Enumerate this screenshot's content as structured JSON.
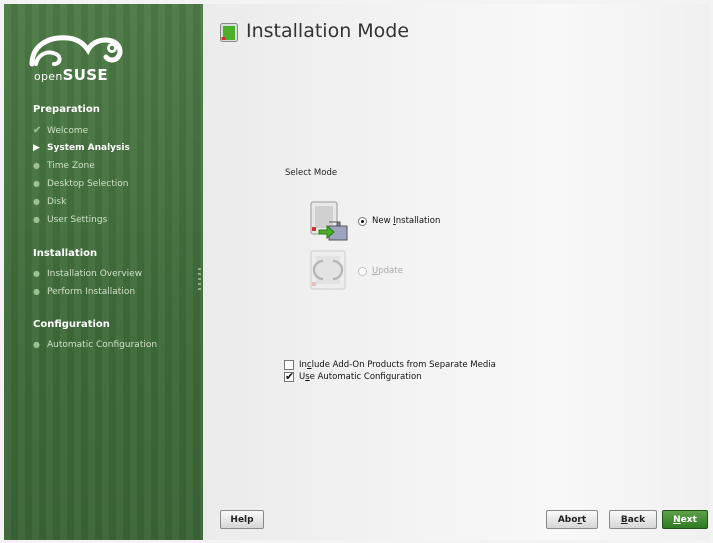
{
  "sidebar": {
    "logo": {
      "prefix": "open",
      "suffix": "SUSE",
      "icon": "chameleon-logo-icon"
    },
    "sections": [
      {
        "title": "Preparation",
        "steps": [
          {
            "label": "Welcome",
            "state": "done"
          },
          {
            "label": "System Analysis",
            "state": "current"
          },
          {
            "label": "Time Zone",
            "state": "pending"
          },
          {
            "label": "Desktop Selection",
            "state": "pending"
          },
          {
            "label": "Disk",
            "state": "pending"
          },
          {
            "label": "User Settings",
            "state": "pending"
          }
        ]
      },
      {
        "title": "Installation",
        "steps": [
          {
            "label": "Installation Overview",
            "state": "pending"
          },
          {
            "label": "Perform Installation",
            "state": "pending"
          }
        ]
      },
      {
        "title": "Configuration",
        "steps": [
          {
            "label": "Automatic Configuration",
            "state": "pending"
          }
        ]
      }
    ],
    "colors": {
      "background": "#3f6b3a",
      "text": "#ffffff"
    }
  },
  "main": {
    "title": "Installation Mode",
    "title_icon": "installation-mode-icon",
    "select_mode_label": "Select Mode",
    "modes": [
      {
        "pre": "New ",
        "mnemonic": "I",
        "post": "nstallation",
        "selected": true,
        "enabled": true,
        "icon": "new-installation-icon"
      },
      {
        "pre": "",
        "mnemonic": "U",
        "post": "pdate",
        "selected": false,
        "enabled": false,
        "icon": "update-icon"
      }
    ],
    "options": [
      {
        "pre": "In",
        "mnemonic": "c",
        "post": "lude Add-On Products from Separate Media",
        "checked": false
      },
      {
        "pre": "U",
        "mnemonic": "s",
        "post": "e Automatic Configuration",
        "checked": true
      }
    ],
    "check_glyph": "✔",
    "buttons": {
      "help": "Help",
      "abort": {
        "pre": "Abo",
        "mnemonic": "r",
        "post": "t"
      },
      "back": {
        "pre": "",
        "mnemonic": "B",
        "post": "ack"
      },
      "next": {
        "pre": "",
        "mnemonic": "N",
        "post": "ext"
      }
    },
    "colors": {
      "accent": "#2f7a24"
    }
  }
}
